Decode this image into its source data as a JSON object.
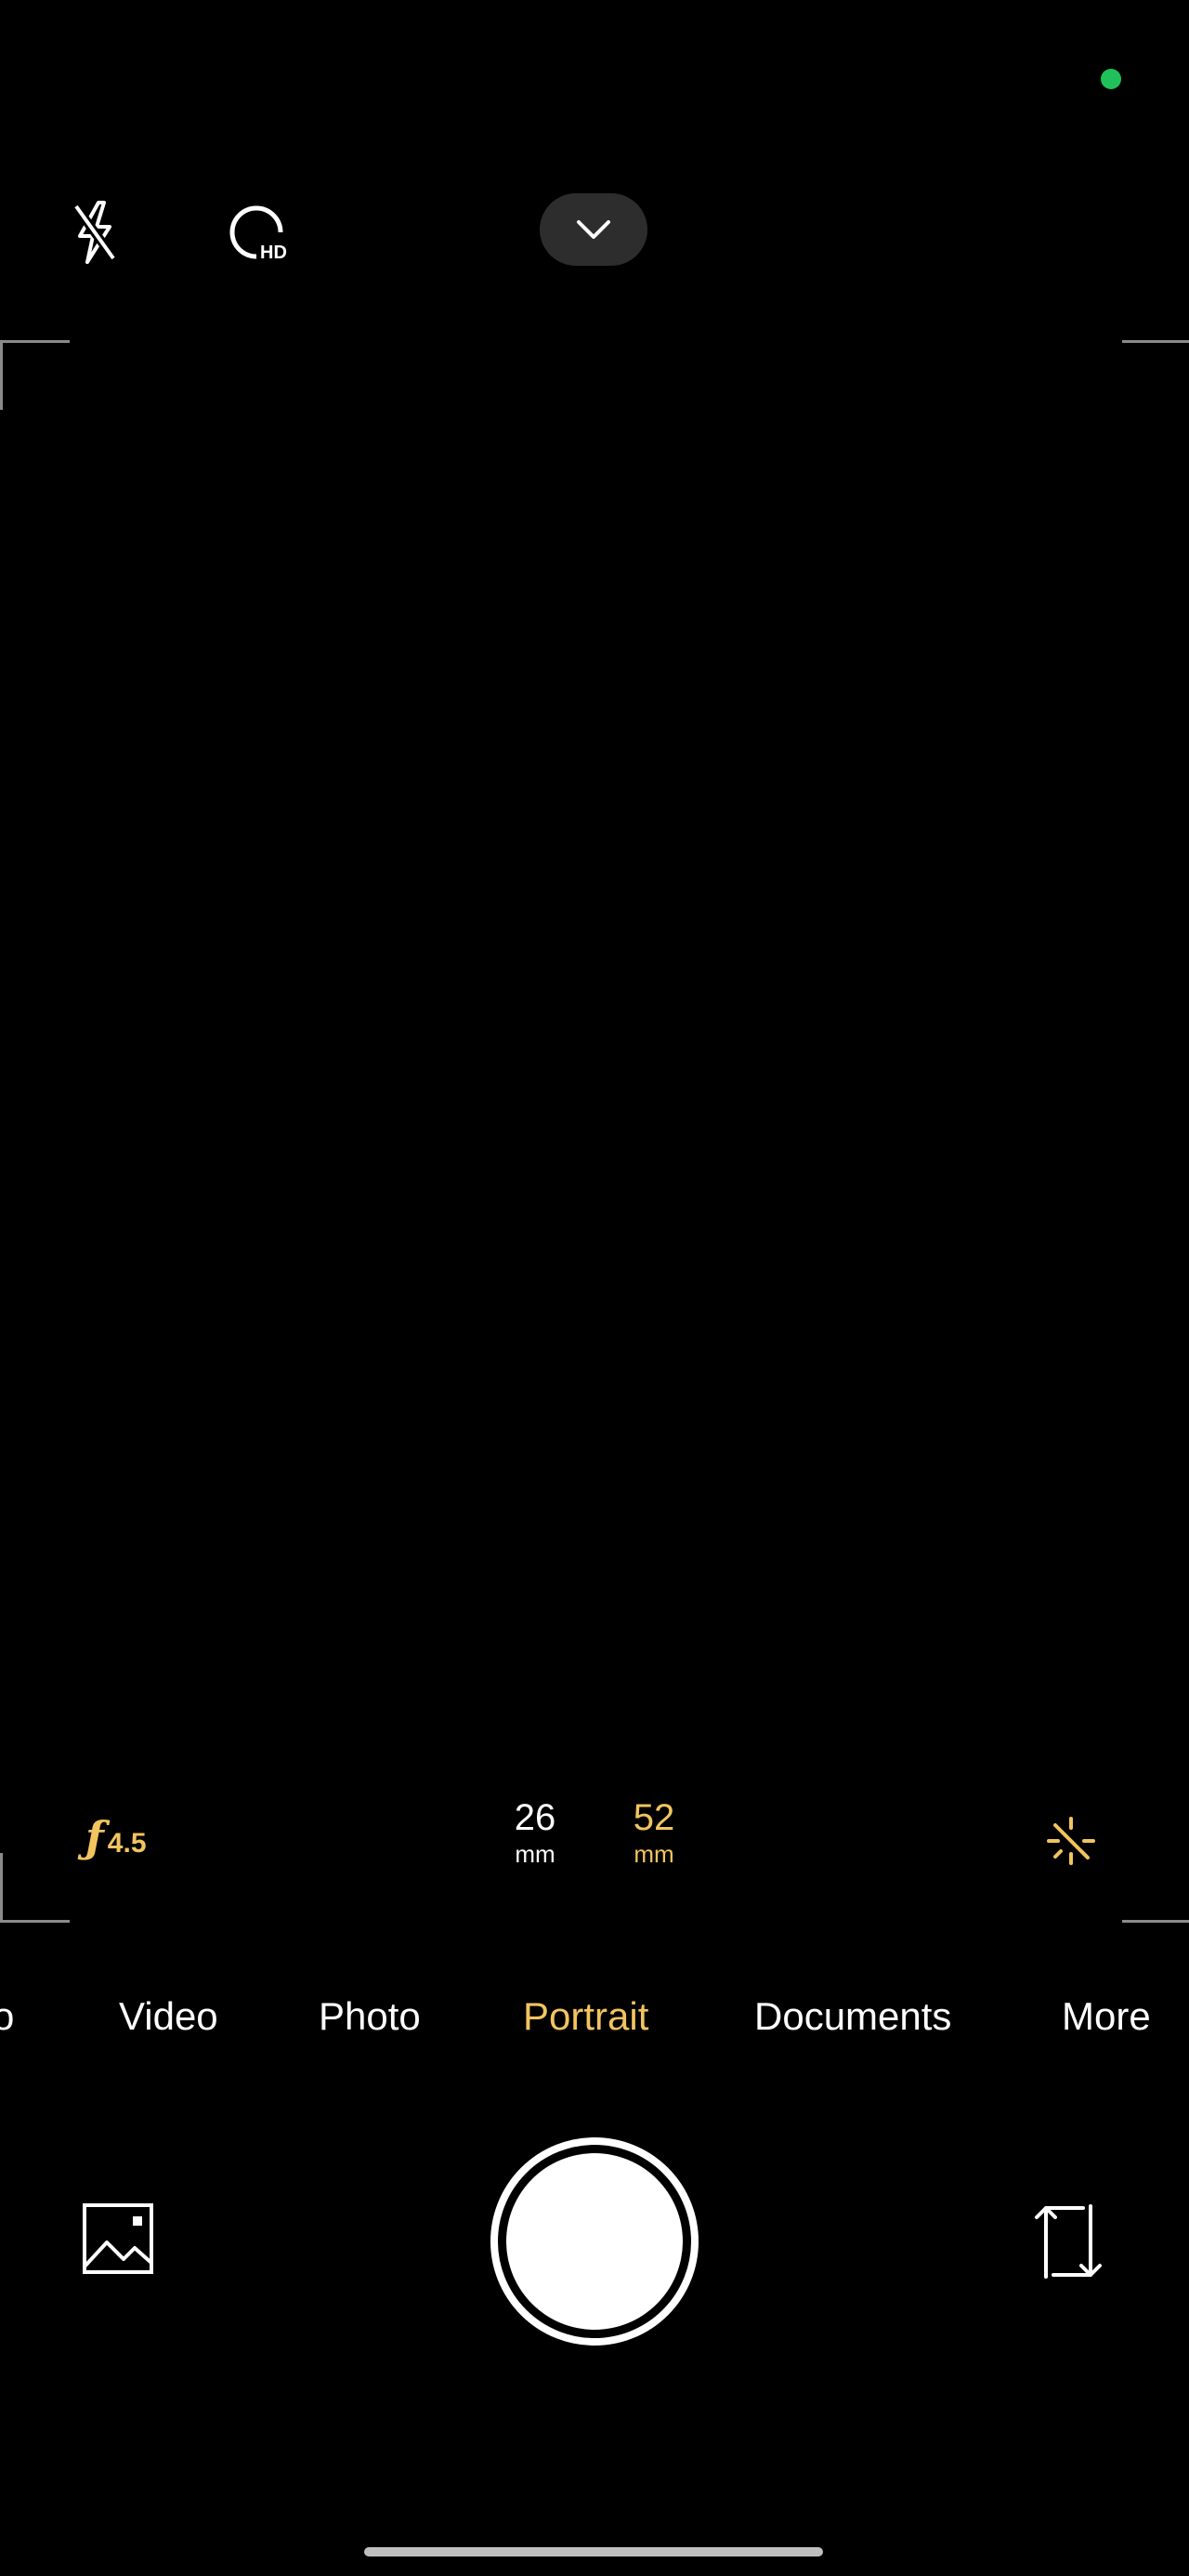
{
  "status": {
    "privacy_indicator_color": "#1fc25a"
  },
  "top_bar": {
    "flash_icon": "flash-off-icon",
    "hd_icon": "hd-icon",
    "hd_label": "HD",
    "collapse_icon": "chevron-down-icon"
  },
  "lens_controls": {
    "aperture_symbol": "ƒ",
    "aperture_value": "4.5",
    "focal_lengths": [
      {
        "value": "26",
        "unit": "mm",
        "active": false
      },
      {
        "value": "52",
        "unit": "mm",
        "active": true
      }
    ],
    "effects_icon": "sparkle-icon"
  },
  "modes": {
    "items": [
      "o",
      "Video",
      "Photo",
      "Portrait",
      "Documents",
      "More"
    ],
    "selected": "Portrait"
  },
  "bottom_controls": {
    "gallery_icon": "gallery-icon",
    "shutter": "shutter-button",
    "switch_icon": "switch-camera-icon"
  },
  "colors": {
    "accent": "#f2c460",
    "background": "#000000",
    "text": "#ffffff"
  }
}
